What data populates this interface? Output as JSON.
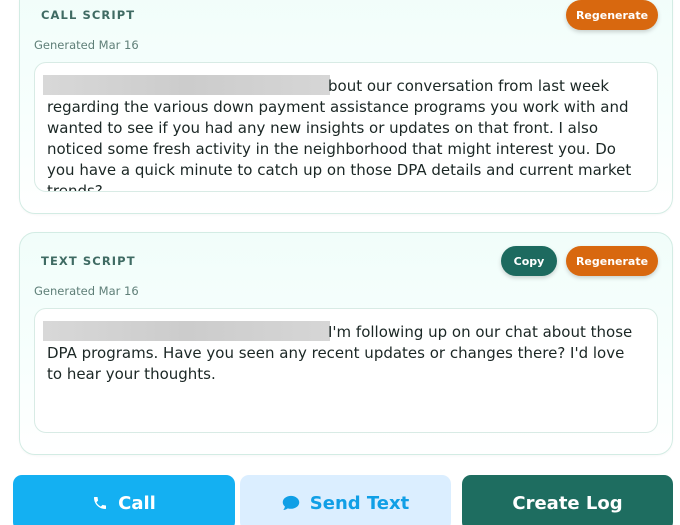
{
  "call_script": {
    "title": "CALL SCRIPT",
    "date": "Generated Mar 16",
    "regenerate_label": "Regenerate",
    "text": "bout our conversation from last week regarding the various down payment assistance programs you work with and wanted to see if you had any new insights or updates on that front. I also noticed some fresh activity in the neighborhood that might interest you. Do you have a quick minute to catch up on those DPA details and current market trends?"
  },
  "text_script": {
    "title": "TEXT SCRIPT",
    "date": "Generated Mar 16",
    "copy_label": "Copy",
    "regenerate_label": "Regenerate",
    "text": "I'm following up on our chat about those DPA programs. Have you seen any recent updates or changes there? I'd love to hear your thoughts."
  },
  "actions": {
    "call_label": "Call",
    "send_text_label": "Send Text",
    "create_log_label": "Create Log"
  },
  "colors": {
    "orange": "#d8680f",
    "teal": "#1e6d60",
    "blue": "#14b0f2",
    "light_blue": "#dbeeff"
  },
  "icons": {
    "call": "phone-icon",
    "send_text": "chat-bubble-icon"
  }
}
